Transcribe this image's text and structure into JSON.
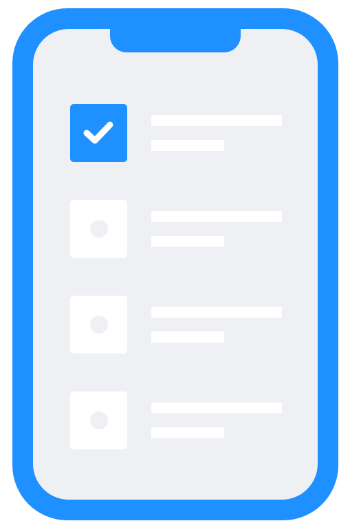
{
  "colors": {
    "frame": "#1e90ff",
    "screen": "#eff0f3",
    "placeholder": "#ffffff",
    "check": "#ffffff"
  },
  "tasks": [
    {
      "state": "checked",
      "icon": "checkmark-icon"
    },
    {
      "state": "unchecked",
      "icon": "dot-icon"
    },
    {
      "state": "unchecked",
      "icon": "dot-icon"
    },
    {
      "state": "unchecked",
      "icon": "dot-icon"
    }
  ]
}
